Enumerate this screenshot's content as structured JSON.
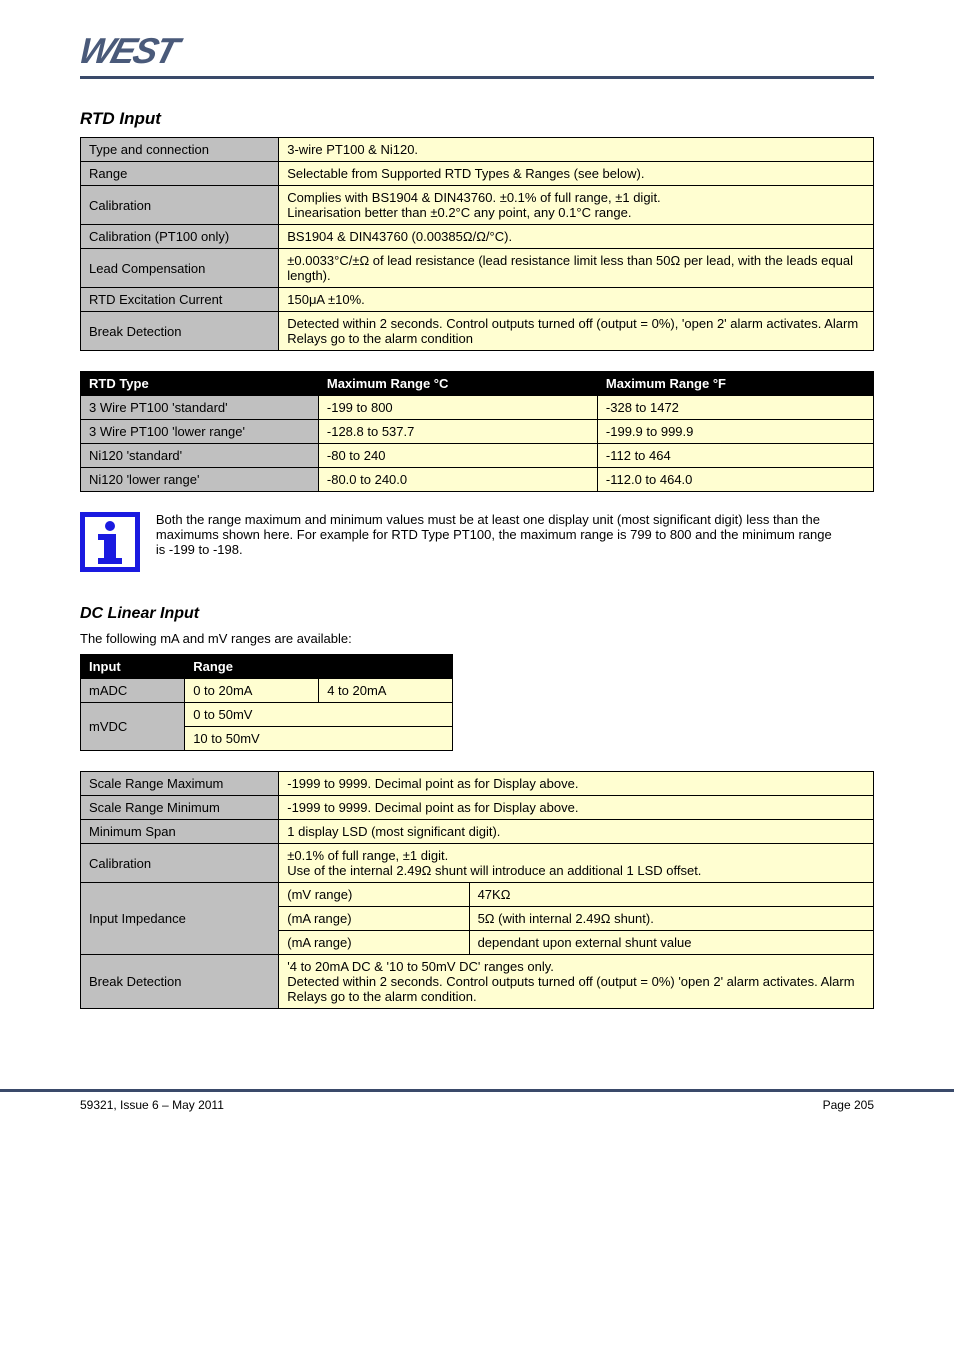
{
  "logo_text": "WEST",
  "section_rtd": "RTD Input",
  "t1": [
    {
      "l": "Type and connection",
      "r": "3-wire PT100 & Ni120."
    },
    {
      "l": "Range",
      "r": "Selectable from Supported RTD Types & Ranges (see below)."
    },
    {
      "l": "Calibration",
      "r": "Complies with BS1904 & DIN43760. ±0.1% of full range, ±1 digit.\nLinearisation better than ±0.2°C any point, any 0.1°C range."
    },
    {
      "l": "Calibration (PT100 only)",
      "r": "BS1904 & DIN43760 (0.00385Ω/Ω/°C)."
    },
    {
      "l": "Lead Compensation",
      "r": "±0.0033°C/±Ω of lead resistance (lead resistance limit less than 50Ω per lead, with the leads equal length)."
    },
    {
      "l": "RTD Excitation Current",
      "r": "150μA ±10%."
    },
    {
      "l": "Break Detection",
      "r": "Detected within 2 seconds. Control outputs turned off (output = 0%), 'open 2' alarm activates. Alarm Relays go to the alarm condition"
    }
  ],
  "t2head": {
    "c0": "RTD Type",
    "c1": "Maximum Range °C",
    "c2": "Maximum Range °F"
  },
  "t2": [
    {
      "c0": "3 Wire PT100 'standard'",
      "c1": "-199 to 800",
      "c2": "-328 to 1472"
    },
    {
      "c0": "3 Wire PT100 'lower range'",
      "c1": "-128.8 to 537.7",
      "c2": "-199.9 to 999.9"
    },
    {
      "c0": "Ni120 'standard'",
      "c1": "-80 to 240",
      "c2": "-112 to 464"
    },
    {
      "c0": "Ni120 'lower range'",
      "c1": "-80.0 to 240.0",
      "c2": "-112.0 to 464.0"
    }
  ],
  "info": "Both the range maximum and minimum values must be at least one display unit (most significant digit) less than the maximums shown here. For example for RTD Type PT100, the maximum range is 799 to 800 and the minimum range is -199 to -198.",
  "section_dc": "DC Linear Input",
  "pre_table": "The following mA and mV ranges are available:",
  "t3head": {
    "c0": "Input",
    "c1": "Range"
  },
  "t3": [
    {
      "c0": "mADC",
      "c1a": "0 to 20mA",
      "c1b": "4 to 20mA",
      "span": true
    },
    {
      "c0": "mVDC",
      "c1a": "0 to 50mV",
      "c1b": "10 to 50mV"
    }
  ],
  "t4": [
    {
      "l": "Scale Range Maximum",
      "r": "-1999 to 9999. Decimal point as for Display above.",
      "sub": []
    },
    {
      "l": "Scale Range Minimum",
      "r": "-1999 to 9999. Decimal point as for Display above.",
      "sub": []
    },
    {
      "l": "Minimum Span",
      "r": "1 display LSD (most significant digit).",
      "sub": []
    },
    {
      "l": "Calibration",
      "r": "±0.1% of full range, ±1 digit.\nUse of the internal 2.49Ω shunt will introduce an additional 1 LSD offset.",
      "sub": []
    },
    {
      "l": "Input Impedance",
      "r": "",
      "sub": [
        {
          "sl": "(mV range)",
          "sr": "47KΩ"
        },
        {
          "sl": "(mA range)",
          "sr": "5Ω (with internal 2.49Ω shunt)."
        },
        {
          "sl": "(mA range)",
          "sr": "dependant upon external shunt value"
        }
      ]
    },
    {
      "l": "Break Detection",
      "r": "'4 to 20mA DC & '10 to 50mV DC' ranges only.\nDetected within 2 seconds. Control outputs turned off (output = 0%) 'open 2' alarm activates. Alarm Relays go to the alarm condition.",
      "sub": []
    }
  ],
  "footer_left": "59321, Issue 6 – May 2011",
  "footer_right": "Page 205"
}
